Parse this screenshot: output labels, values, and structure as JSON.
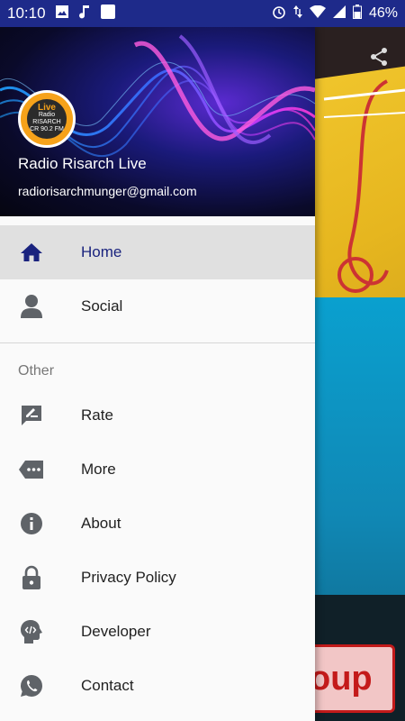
{
  "statusbar": {
    "time": "10:10",
    "battery": "46%",
    "icons_left": [
      "image-icon",
      "music-note-icon",
      "white-square-icon"
    ],
    "icons_right": [
      "alarm-icon",
      "data-arrows-icon",
      "wifi-icon",
      "signal-icon",
      "battery-icon"
    ]
  },
  "drawer": {
    "header": {
      "app_name": "Radio Risarch Live",
      "email": "radiorisarchmunger@gmail.com",
      "logo": {
        "live": "Live",
        "brand_top": "Radio",
        "brand": "RISARCH",
        "freq": "CR 90.2 FM"
      }
    },
    "menu": [
      {
        "label": "Home",
        "icon": "home-icon",
        "selected": true
      },
      {
        "label": "Social",
        "icon": "person-icon",
        "selected": false
      }
    ],
    "section_title": "Other",
    "other_menu": [
      {
        "label": "Rate",
        "icon": "rate-edit-icon"
      },
      {
        "label": "More",
        "icon": "more-tag-icon"
      },
      {
        "label": "About",
        "icon": "info-icon"
      },
      {
        "label": "Privacy Policy",
        "icon": "lock-icon"
      },
      {
        "label": "Developer",
        "icon": "developer-head-icon"
      },
      {
        "label": "Contact",
        "icon": "whatsapp-icon"
      }
    ]
  },
  "background": {
    "partial_text": "oup"
  },
  "colors": {
    "statusbar": "#1e2a8a",
    "selected_text": "#1a237e",
    "selected_bg": "#e0e0e0",
    "icon_gray": "#5f6368",
    "home_icon": "#1a237e"
  }
}
